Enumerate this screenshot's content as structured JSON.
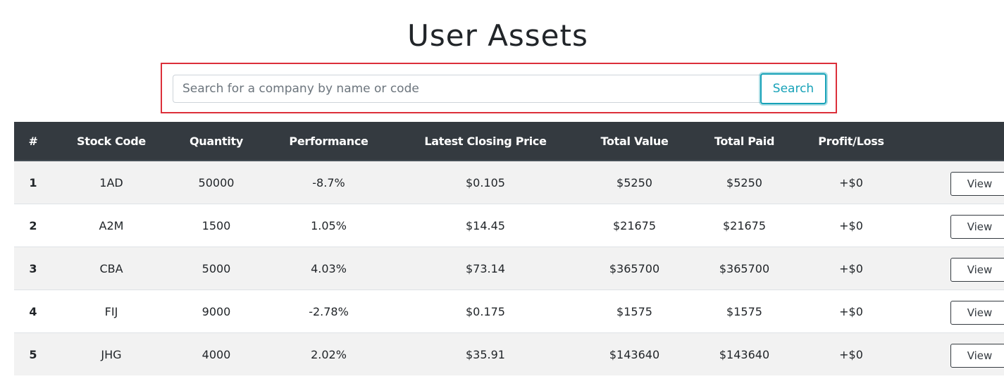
{
  "page": {
    "title": "User Assets"
  },
  "search": {
    "placeholder": "Search for a company by name or code",
    "value": "",
    "button_label": "Search"
  },
  "colors": {
    "header_bg": "#343a40",
    "negative": "#dc3545",
    "positive": "#28a745",
    "search_accent": "#17a2b8",
    "highlight_frame": "#dc2f3a"
  },
  "table": {
    "headers": [
      "#",
      "Stock Code",
      "Quantity",
      "Performance",
      "Latest Closing Price",
      "Total Value",
      "Total Paid",
      "Profit/Loss",
      ""
    ],
    "rows": [
      {
        "num": "1",
        "code": "1AD",
        "quantity": "50000",
        "performance": "-8.7%",
        "performance_trend": "negative",
        "closing": "$0.105",
        "total_value": "$5250",
        "total_paid": "$5250",
        "profit_loss": "+$0",
        "action": "View"
      },
      {
        "num": "2",
        "code": "A2M",
        "quantity": "1500",
        "performance": "1.05%",
        "performance_trend": "positive",
        "closing": "$14.45",
        "total_value": "$21675",
        "total_paid": "$21675",
        "profit_loss": "+$0",
        "action": "View"
      },
      {
        "num": "3",
        "code": "CBA",
        "quantity": "5000",
        "performance": "4.03%",
        "performance_trend": "positive",
        "closing": "$73.14",
        "total_value": "$365700",
        "total_paid": "$365700",
        "profit_loss": "+$0",
        "action": "View"
      },
      {
        "num": "4",
        "code": "FIJ",
        "quantity": "9000",
        "performance": "-2.78%",
        "performance_trend": "negative",
        "closing": "$0.175",
        "total_value": "$1575",
        "total_paid": "$1575",
        "profit_loss": "+$0",
        "action": "View"
      },
      {
        "num": "5",
        "code": "JHG",
        "quantity": "4000",
        "performance": "2.02%",
        "performance_trend": "positive",
        "closing": "$35.91",
        "total_value": "$143640",
        "total_paid": "$143640",
        "profit_loss": "+$0",
        "action": "View"
      }
    ]
  }
}
